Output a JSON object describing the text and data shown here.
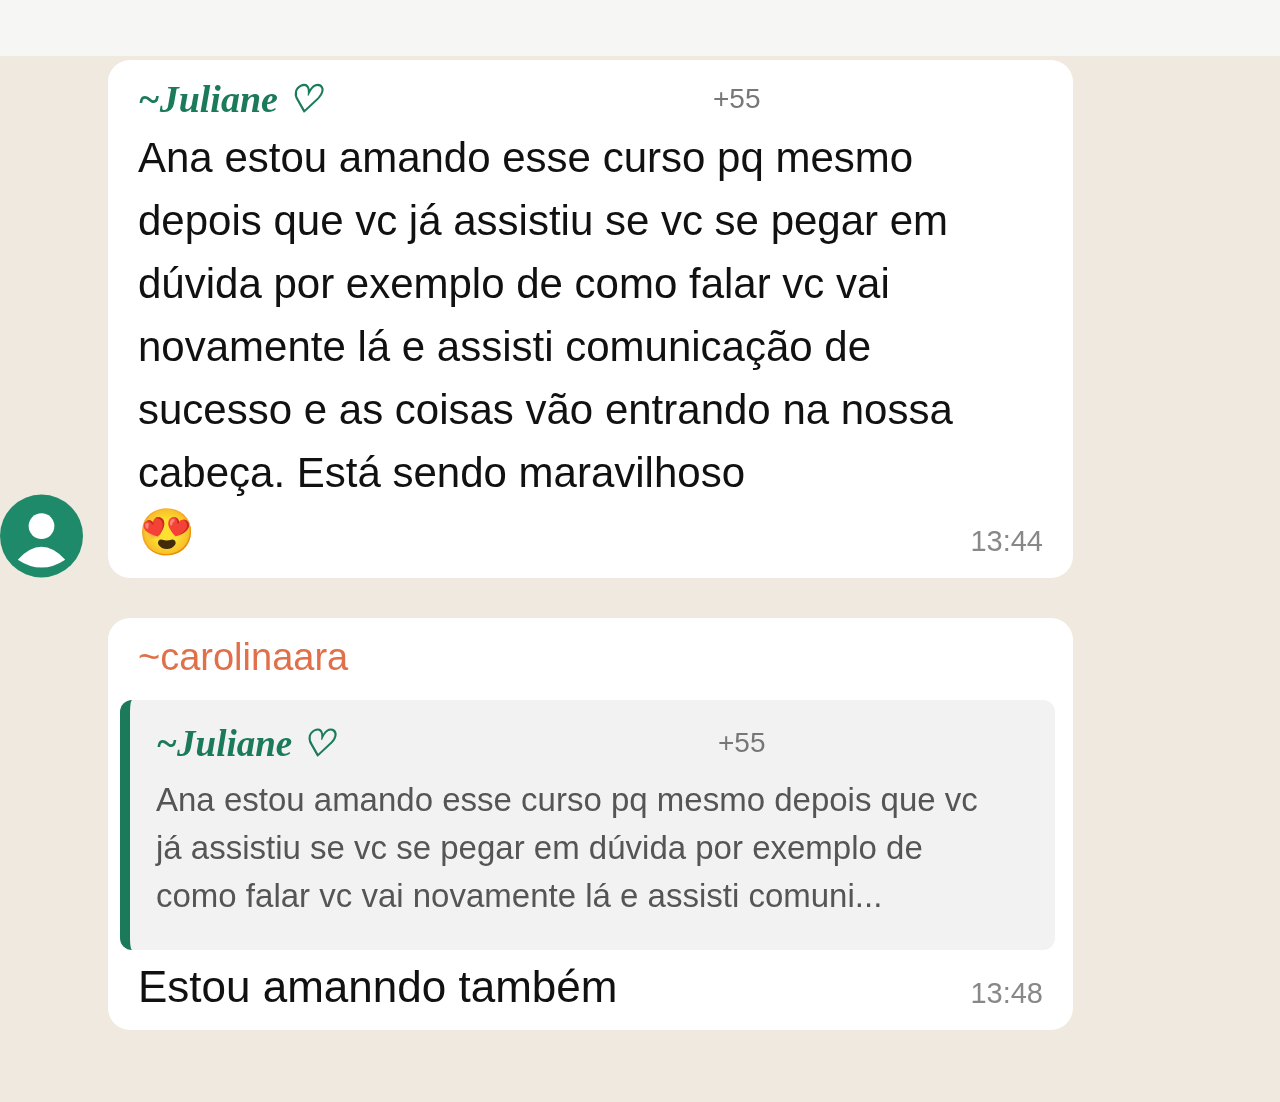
{
  "messages": [
    {
      "sender": "~Juliane ♡",
      "color": "#1b7a5a",
      "phone": "+55",
      "show_avatar": true,
      "text": "Ana estou amando esse curso pq mesmo depois que vc já assistiu se vc se pegar em dúvida por exemplo de como falar vc vai novamente lá e assisti comunicação de sucesso e as coisas vão entrando na nossa cabeça. Está sendo maravilhoso",
      "emoji": "😍",
      "time": "13:44"
    },
    {
      "sender": "~carolinaara",
      "color": "#e0704a",
      "show_avatar": false,
      "quote": {
        "sender": "~Juliane ♡",
        "color": "#1b7a5a",
        "phone": "+55",
        "text": "Ana estou amando esse curso pq mesmo depois que vc já assistiu se vc se pegar em dúvida por exemplo de como falar vc vai novamente lá e assisti comuni..."
      },
      "text": "Estou amanndo também",
      "time": "13:48"
    }
  ]
}
